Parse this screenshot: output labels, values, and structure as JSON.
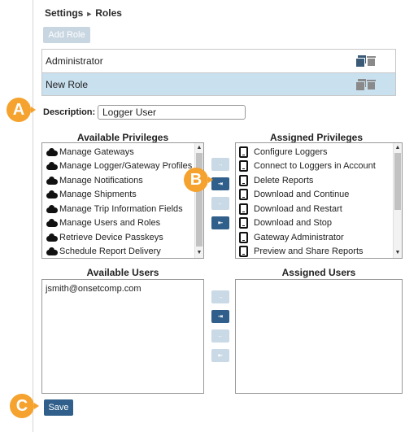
{
  "breadcrumb": {
    "parent": "Settings",
    "current": "Roles"
  },
  "toolbar": {
    "add_role_label": "Add Role"
  },
  "roles": [
    {
      "name": "Administrator",
      "selected": false
    },
    {
      "name": "New Role",
      "selected": true
    }
  ],
  "description": {
    "label": "Description:",
    "value": "Logger User"
  },
  "available_privileges": {
    "title": "Available Privileges",
    "items": [
      "Manage Gateways",
      "Manage Logger/Gateway Profiles",
      "Manage Notifications",
      "Manage Shipments",
      "Manage Trip Information Fields",
      "Manage Users and Roles",
      "Retrieve Device Passkeys",
      "Schedule Report Delivery"
    ]
  },
  "assigned_privileges": {
    "title": "Assigned Privileges",
    "items": [
      "Configure Loggers",
      "Connect to Loggers in Account",
      "Delete Reports",
      "Download and Continue",
      "Download and Restart",
      "Download and Stop",
      "Gateway Administrator",
      "Preview and Share Reports"
    ]
  },
  "available_users": {
    "title": "Available Users",
    "items": [
      "jsmith@onsetcomp.com"
    ]
  },
  "assigned_users": {
    "title": "Assigned Users",
    "items": []
  },
  "move_buttons": {
    "add": "→",
    "add_all": "⇥",
    "remove": "←",
    "remove_all": "⇤"
  },
  "save_label": "Save",
  "callouts": {
    "a": "A",
    "b": "B",
    "c": "C"
  },
  "colors": {
    "accent": "#2f5f8a",
    "selected_row": "#c9e0ef",
    "callout": "#f5a22e"
  }
}
